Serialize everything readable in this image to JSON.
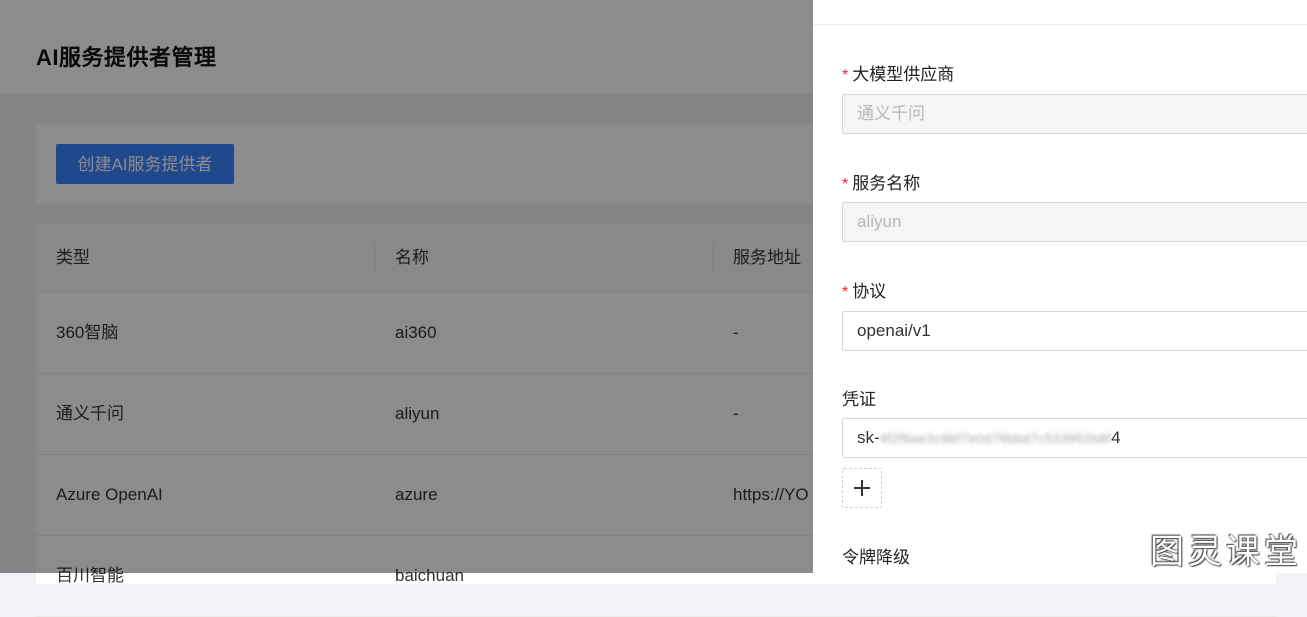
{
  "page": {
    "title": "AI服务提供者管理",
    "create_button": "创建AI服务提供者"
  },
  "table": {
    "columns": [
      "类型",
      "名称",
      "服务地址"
    ],
    "rows": [
      [
        "360智脑",
        "ai360",
        "-"
      ],
      [
        "通义千问",
        "aliyun",
        "-"
      ],
      [
        "Azure OpenAI",
        "azure",
        "https://YO"
      ],
      [
        "百川智能",
        "baichuan",
        ""
      ]
    ]
  },
  "drawer": {
    "fields": {
      "provider": {
        "label": "大模型供应商",
        "value": "通义千问",
        "required": true,
        "disabled": true
      },
      "service_name": {
        "label": "服务名称",
        "value": "aliyun",
        "required": true,
        "disabled": true
      },
      "protocol": {
        "label": "协议",
        "value": "openai/v1",
        "required": true
      },
      "credential": {
        "label": "凭证",
        "prefix": "sk-",
        "masked": "4f2f6ae3c9bf7e0d76bbd7c533952b8f",
        "suffix": "4"
      },
      "token_downgrade": {
        "label": "令牌降级"
      }
    },
    "required_mark": "*",
    "add_icon": "plus-icon"
  },
  "watermark": "图灵课堂",
  "colors": {
    "primary": "#3b83ff",
    "required": "#f5222d",
    "overlay": "rgba(0,0,0,0.45)"
  }
}
